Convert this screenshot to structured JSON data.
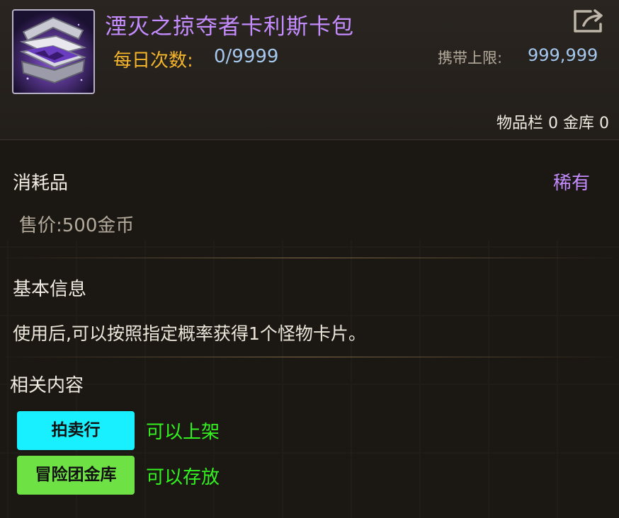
{
  "item": {
    "name": "湮灭之掠夺者卡利斯卡包",
    "icon": "card-pack-icon",
    "daily_label": "每日次数:",
    "daily_value": "0/9999",
    "carry_label": "携带上限:",
    "carry_value": "999,999",
    "storage": {
      "inventory_label": "物品栏",
      "inventory_count": "0",
      "vault_label": "金库",
      "vault_count": "0"
    }
  },
  "details": {
    "category": "消耗品",
    "rarity": "稀有",
    "price": "售价:500金币"
  },
  "basic_info": {
    "title": "基本信息",
    "description": "使用后,可以按照指定概率获得1个怪物卡片。"
  },
  "related": {
    "title": "相关内容",
    "items": [
      {
        "button": "拍卖行",
        "status": "可以上架",
        "color": "#18f0ff"
      },
      {
        "button": "冒险团金库",
        "status": "可以存放",
        "color": "#6ee245"
      }
    ]
  },
  "colors": {
    "title_purple": "#c58cff",
    "gold": "#f4b52b",
    "blue_value": "#a5c8ee",
    "green_status": "#33f220"
  }
}
